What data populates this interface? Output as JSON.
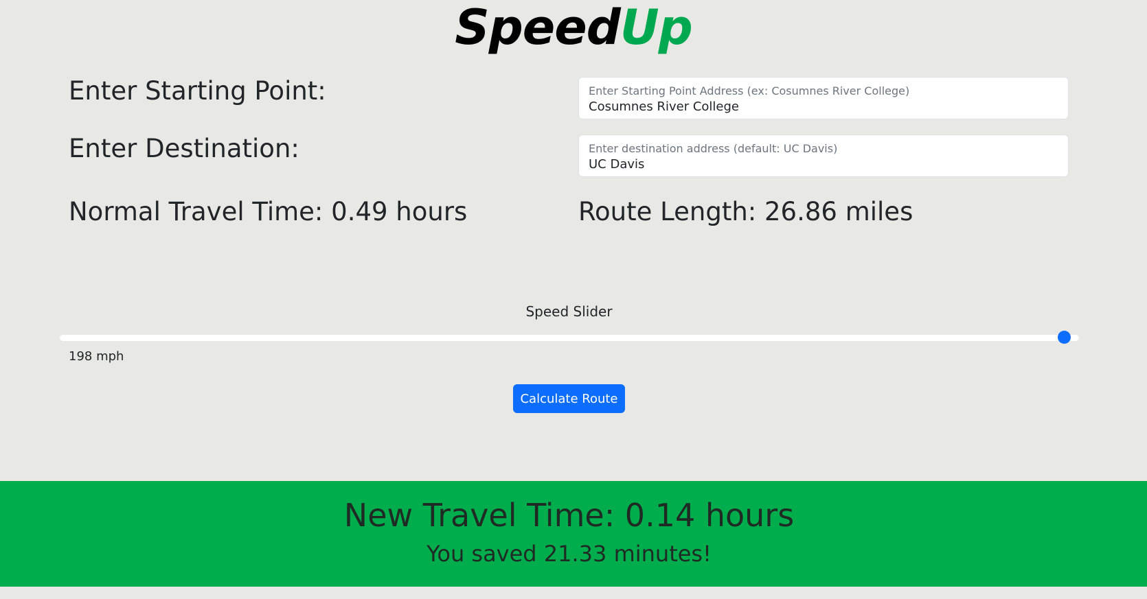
{
  "logo": {
    "part1": "Speed",
    "part2": "Up"
  },
  "form": {
    "start_label": "Enter Starting Point:",
    "start_placeholder": "Enter Starting Point Address (ex: Cosumnes River College)",
    "start_value": "Cosumnes River College",
    "dest_label": "Enter Destination:",
    "dest_placeholder": "Enter destination address (default: UC Davis)",
    "dest_value": "UC Davis"
  },
  "stats": {
    "normal_time": "Normal Travel Time: 0.49 hours",
    "route_length": "Route Length: 26.86 miles"
  },
  "slider": {
    "title": "Speed Slider",
    "value_fraction": 0.985,
    "readout": "198 mph"
  },
  "button": {
    "calculate_label": "Calculate Route"
  },
  "result": {
    "new_time": "New Travel Time: 0.14 hours",
    "saved": "You saved 21.33 minutes!"
  },
  "colors": {
    "page_bg": "#e8e8e4",
    "accent_blue": "#0d6efd",
    "result_green": "#00ad4c",
    "logo_green": "#00a94f"
  }
}
